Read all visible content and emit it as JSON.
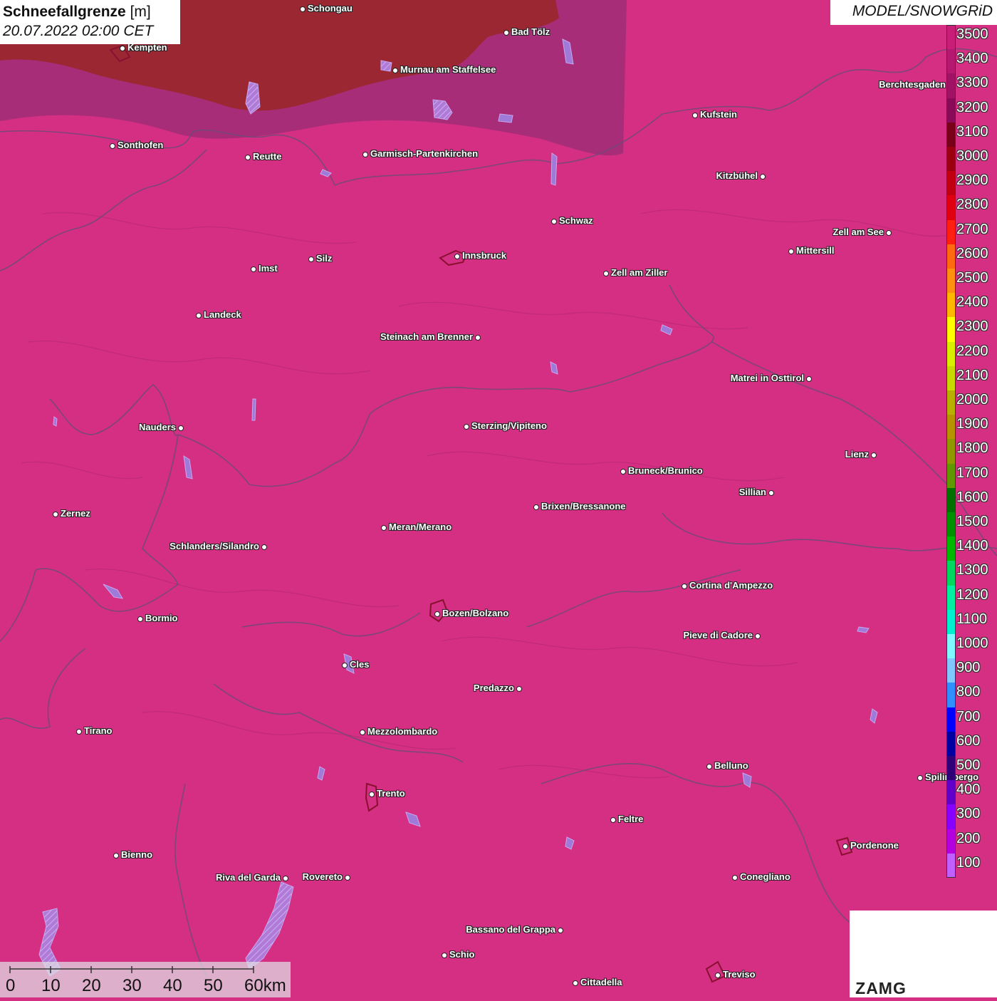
{
  "header": {
    "title_bold": "Schneefallgrenze",
    "title_unit": "[m]",
    "datetime": "20.07.2022 02:00 CET",
    "model": "MODEL/SNOWGRiD"
  },
  "legend": {
    "unit": "m",
    "levels": [
      {
        "label": "3500",
        "color": "#c81e78"
      },
      {
        "label": "3400",
        "color": "#b41870"
      },
      {
        "label": "3300",
        "color": "#a01266"
      },
      {
        "label": "3200",
        "color": "#8a0a5a"
      },
      {
        "label": "3100",
        "color": "#780018"
      },
      {
        "label": "3000",
        "color": "#9c0010"
      },
      {
        "label": "2900",
        "color": "#c00010"
      },
      {
        "label": "2800",
        "color": "#e00010"
      },
      {
        "label": "2700",
        "color": "#ff2010"
      },
      {
        "label": "2600",
        "color": "#ff6a10"
      },
      {
        "label": "2500",
        "color": "#ff9010"
      },
      {
        "label": "2400",
        "color": "#ffb800"
      },
      {
        "label": "2300",
        "color": "#ffff00"
      },
      {
        "label": "2200",
        "color": "#d8f000"
      },
      {
        "label": "2100",
        "color": "#c8d800"
      },
      {
        "label": "2000",
        "color": "#b8b000"
      },
      {
        "label": "1900",
        "color": "#b49400"
      },
      {
        "label": "1800",
        "color": "#909800"
      },
      {
        "label": "1700",
        "color": "#609800"
      },
      {
        "label": "1600",
        "color": "#007000"
      },
      {
        "label": "1500",
        "color": "#009000"
      },
      {
        "label": "1400",
        "color": "#00b800"
      },
      {
        "label": "1300",
        "color": "#00d860"
      },
      {
        "label": "1200",
        "color": "#00f0a0"
      },
      {
        "label": "1100",
        "color": "#00f0d0"
      },
      {
        "label": "1000",
        "color": "#80f8ff"
      },
      {
        "label": "900",
        "color": "#80c8ff"
      },
      {
        "label": "800",
        "color": "#3090ff"
      },
      {
        "label": "700",
        "color": "#0000ff"
      },
      {
        "label": "600",
        "color": "#0000a0"
      },
      {
        "label": "500",
        "color": "#300078"
      },
      {
        "label": "400",
        "color": "#6000c8"
      },
      {
        "label": "300",
        "color": "#8800ff"
      },
      {
        "label": "200",
        "color": "#b400e0"
      },
      {
        "label": "100",
        "color": "#c060ff"
      }
    ]
  },
  "map_colors": {
    "background": "#d42f82",
    "north_band": "#a02d78",
    "high_zone": "#9a2732",
    "lakes": "#a07ad8",
    "borders": "#6e4a78"
  },
  "scalebar": {
    "ticks": [
      "0",
      "10",
      "20",
      "30",
      "40",
      "50",
      "60km"
    ]
  },
  "logos": {
    "zamg_text": "ZAMG"
  },
  "cities": [
    {
      "name": "Schongau",
      "side": "r"
    },
    {
      "name": "Bad Tölz",
      "side": "r"
    },
    {
      "name": "Kempten",
      "side": "r"
    },
    {
      "name": "Murnau am Staffelsee",
      "side": "r"
    },
    {
      "name": "Berchtesgaden",
      "side": "l"
    },
    {
      "name": "Kufstein",
      "side": "r"
    },
    {
      "name": "Sonthofen",
      "side": "r"
    },
    {
      "name": "Reutte",
      "side": "r"
    },
    {
      "name": "Garmisch-Partenkirchen",
      "side": "r"
    },
    {
      "name": "Kitzbühel",
      "side": "l"
    },
    {
      "name": "Schwaz",
      "side": "r"
    },
    {
      "name": "Zell am See",
      "side": "l"
    },
    {
      "name": "Mittersill",
      "side": "r"
    },
    {
      "name": "Innsbruck",
      "side": "r"
    },
    {
      "name": "Imst",
      "side": "r"
    },
    {
      "name": "Silz",
      "side": "r"
    },
    {
      "name": "Zell am Ziller",
      "side": "r"
    },
    {
      "name": "Landeck",
      "side": "r"
    },
    {
      "name": "Steinach am Brenner",
      "side": "l"
    },
    {
      "name": "Matrei in Osttirol",
      "side": "l"
    },
    {
      "name": "Nauders",
      "side": "l"
    },
    {
      "name": "Sterzing/Vipiteno",
      "side": "r"
    },
    {
      "name": "Lienz",
      "side": "l"
    },
    {
      "name": "Bruneck/Brunico",
      "side": "r"
    },
    {
      "name": "Sillian",
      "side": "l"
    },
    {
      "name": "Zernez",
      "side": "r"
    },
    {
      "name": "Brixen/Bressanone",
      "side": "r"
    },
    {
      "name": "Meran/Merano",
      "side": "r"
    },
    {
      "name": "Schlanders/Silandro",
      "side": "l"
    },
    {
      "name": "Cortina d'Ampezzo",
      "side": "r"
    },
    {
      "name": "Bozen/Bolzano",
      "side": "r"
    },
    {
      "name": "Bormio",
      "side": "r"
    },
    {
      "name": "Pieve di Cadore",
      "side": "l"
    },
    {
      "name": "Cles",
      "side": "r"
    },
    {
      "name": "Predazzo",
      "side": "l"
    },
    {
      "name": "Tirano",
      "side": "r"
    },
    {
      "name": "Mezzolombardo",
      "side": "r"
    },
    {
      "name": "Belluno",
      "side": "r"
    },
    {
      "name": "Spilimbergo",
      "side": "r"
    },
    {
      "name": "Trento",
      "side": "r"
    },
    {
      "name": "Feltre",
      "side": "r"
    },
    {
      "name": "Pordenone",
      "side": "r"
    },
    {
      "name": "Bienno",
      "side": "r"
    },
    {
      "name": "Riva del Garda",
      "side": "l"
    },
    {
      "name": "Rovereto",
      "side": "l"
    },
    {
      "name": "Conegliano",
      "side": "r"
    },
    {
      "name": "Bassano del Grappa",
      "side": "l"
    },
    {
      "name": "Schio",
      "side": "r"
    },
    {
      "name": "Treviso",
      "side": "r"
    },
    {
      "name": "Cittadella",
      "side": "r"
    }
  ]
}
